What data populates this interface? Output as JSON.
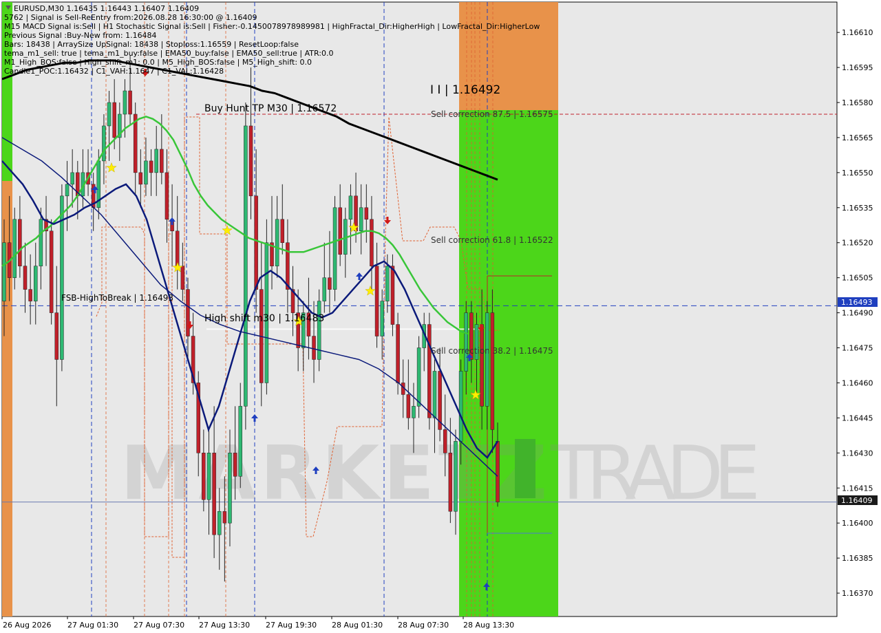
{
  "colors": {
    "background": "#ffffff",
    "plot_background": "#e8e8e8",
    "bull": "#2eb872",
    "bear": "#c0202a",
    "ema50": "#39c639",
    "ema200": "#000000",
    "fast_ma": "#0b1a7a",
    "slow_ma": "#0b1a7a",
    "orange_zone": "#e8924a",
    "green_zone": "#4cd61a",
    "dash_blue": "#1f3fbf",
    "price_box_bg": "#1a1a1a",
    "fsb_box_bg": "#1f3fbf"
  },
  "info_lines": [
    "EURUSD,M30  1.16435 1.16443 1.16407 1.16409",
    "5762 | Signal is Sell-ReEntry from:2026.08.28 16:30:00 @ 1.16409",
    "M15 MACD Signal is:Sell | H1 Stochastic Signal is:Sell | Fisher:-0.1450078978989981 | HighFractal_Dir:HigherHigh | LowFractal_Dir:HigherLow",
    "Previous Signal :Buy-New from: 1.16484",
    "Bars: 18438 | ArraySize UpSignal: 18438 | Stoploss:1.16559 | ResetLoop:false",
    "tema_m1_sell: true | tema_m1_buy:false | EMA50_buy:false | EMA50_sell:true | ATR:0.0",
    "M1_High_BOS:false | High_shift_m1: 0.0 | M5_High_BOS:false | M5_High_shift: 0.0",
    "Candle1_POC:1.16432 | C1_VAH:1.1647 | C1_VAL:1.16428"
  ],
  "annotations": {
    "buy_hunt": "Buy Hunt TP M30 | 1.16572",
    "marker": "I I | 1.16492",
    "sell_875": "Sell correction 87.5 | 1.16575",
    "sell_618": "Sell correction 61.8 | 1.16522",
    "sell_382": "Sell correction 38.2 | 1.16475",
    "fsb": "FSB-HighToBreak | 1.16493",
    "high_shift": "High shift m30 | 1.16483"
  },
  "watermark": {
    "left": "MARKETZ",
    "right": "TRADE"
  },
  "chart_data": {
    "type": "candlestick",
    "symbol": "EURUSD",
    "timeframe": "M30",
    "ylim": [
      1.1636,
      1.16623
    ],
    "y_ticks": [
      "1.16610",
      "1.16595",
      "1.16580",
      "1.16565",
      "1.16550",
      "1.16535",
      "1.16520",
      "1.16505",
      "1.16490",
      "1.16475",
      "1.16460",
      "1.16445",
      "1.16430",
      "1.16415",
      "1.16400",
      "1.16385",
      "1.16370"
    ],
    "x_ticks": [
      "26 Aug 2026",
      "27 Aug 01:30",
      "27 Aug 07:30",
      "27 Aug 13:30",
      "27 Aug 19:30",
      "28 Aug 01:30",
      "28 Aug 07:30",
      "28 Aug 13:30"
    ],
    "current_price": "1.16409",
    "fsb_level": "1.16493",
    "levels": {
      "buy_hunt_tp": 1.16572,
      "sell_correction_875": 1.16575,
      "sell_correction_618": 1.16522,
      "sell_correction_382": 1.16475,
      "fsb_high_to_break": 1.16493,
      "high_shift_m30": 1.16483,
      "current": 1.16409
    },
    "candles": [
      [
        1.16495,
        1.1653,
        1.1648,
        1.1652
      ],
      [
        1.1652,
        1.1654,
        1.16495,
        1.16505
      ],
      [
        1.16505,
        1.16535,
        1.165,
        1.1653
      ],
      [
        1.1653,
        1.1654,
        1.16505,
        1.1651
      ],
      [
        1.1651,
        1.1652,
        1.1649,
        1.165
      ],
      [
        1.165,
        1.16515,
        1.16485,
        1.16495
      ],
      [
        1.16495,
        1.1652,
        1.16485,
        1.1651
      ],
      [
        1.1651,
        1.16535,
        1.165,
        1.1653
      ],
      [
        1.1653,
        1.1654,
        1.1651,
        1.16525
      ],
      [
        1.16525,
        1.1653,
        1.16485,
        1.1649
      ],
      [
        1.1649,
        1.1651,
        1.1645,
        1.1647
      ],
      [
        1.1647,
        1.16545,
        1.16465,
        1.1654
      ],
      [
        1.1654,
        1.16555,
        1.16525,
        1.16545
      ],
      [
        1.16545,
        1.1656,
        1.16535,
        1.1655
      ],
      [
        1.1655,
        1.16555,
        1.1653,
        1.1654
      ],
      [
        1.1654,
        1.1656,
        1.16535,
        1.1655
      ],
      [
        1.1655,
        1.1656,
        1.1654,
        1.16545
      ],
      [
        1.16545,
        1.1655,
        1.16525,
        1.16535
      ],
      [
        1.16535,
        1.1656,
        1.1653,
        1.16555
      ],
      [
        1.16555,
        1.16575,
        1.16545,
        1.1657
      ],
      [
        1.1657,
        1.16585,
        1.16555,
        1.1658
      ],
      [
        1.1658,
        1.1659,
        1.1656,
        1.16565
      ],
      [
        1.16565,
        1.1658,
        1.16555,
        1.16575
      ],
      [
        1.16575,
        1.1659,
        1.16565,
        1.16585
      ],
      [
        1.16585,
        1.166,
        1.1657,
        1.16575
      ],
      [
        1.16575,
        1.1658,
        1.1654,
        1.1655
      ],
      [
        1.1655,
        1.1656,
        1.16535,
        1.16545
      ],
      [
        1.16545,
        1.16565,
        1.1654,
        1.16555
      ],
      [
        1.16555,
        1.1656,
        1.1654,
        1.1655
      ],
      [
        1.1655,
        1.1657,
        1.1654,
        1.1656
      ],
      [
        1.1656,
        1.16575,
        1.16545,
        1.1655
      ],
      [
        1.1655,
        1.1656,
        1.1652,
        1.1653
      ],
      [
        1.1653,
        1.16545,
        1.1651,
        1.16525
      ],
      [
        1.16525,
        1.1654,
        1.165,
        1.1651
      ],
      [
        1.1651,
        1.1652,
        1.16495,
        1.165
      ],
      [
        1.165,
        1.16505,
        1.1647,
        1.1648
      ],
      [
        1.1648,
        1.1649,
        1.16455,
        1.1646
      ],
      [
        1.1646,
        1.16465,
        1.1642,
        1.1643
      ],
      [
        1.1643,
        1.1644,
        1.16405,
        1.1641
      ],
      [
        1.1641,
        1.1644,
        1.16395,
        1.1643
      ],
      [
        1.1643,
        1.1645,
        1.16385,
        1.16395
      ],
      [
        1.16395,
        1.16415,
        1.1638,
        1.16405
      ],
      [
        1.16405,
        1.1642,
        1.16375,
        1.164
      ],
      [
        1.164,
        1.1644,
        1.1639,
        1.1643
      ],
      [
        1.1643,
        1.1645,
        1.1641,
        1.1642
      ],
      [
        1.1642,
        1.1646,
        1.16415,
        1.1645
      ],
      [
        1.1645,
        1.1658,
        1.1644,
        1.1657
      ],
      [
        1.1657,
        1.16595,
        1.1653,
        1.1654
      ],
      [
        1.1654,
        1.1656,
        1.1649,
        1.165
      ],
      [
        1.165,
        1.1652,
        1.1645,
        1.1646
      ],
      [
        1.1646,
        1.1653,
        1.16455,
        1.1652
      ],
      [
        1.1652,
        1.1654,
        1.165,
        1.1651
      ],
      [
        1.1651,
        1.1654,
        1.16505,
        1.1653
      ],
      [
        1.1653,
        1.16545,
        1.16515,
        1.1652
      ],
      [
        1.1652,
        1.1653,
        1.1649,
        1.165
      ],
      [
        1.165,
        1.1651,
        1.1648,
        1.1649
      ],
      [
        1.1649,
        1.165,
        1.16465,
        1.16475
      ],
      [
        1.16475,
        1.16495,
        1.16465,
        1.1649
      ],
      [
        1.1649,
        1.16505,
        1.1647,
        1.1648
      ],
      [
        1.1648,
        1.16495,
        1.1646,
        1.1647
      ],
      [
        1.1647,
        1.165,
        1.16465,
        1.16495
      ],
      [
        1.16495,
        1.1652,
        1.1649,
        1.16505
      ],
      [
        1.16505,
        1.16525,
        1.1649,
        1.165
      ],
      [
        1.165,
        1.1654,
        1.16495,
        1.16535
      ],
      [
        1.16535,
        1.16545,
        1.1651,
        1.16515
      ],
      [
        1.16515,
        1.16535,
        1.16505,
        1.1653
      ],
      [
        1.1653,
        1.16545,
        1.16515,
        1.1654
      ],
      [
        1.1654,
        1.1655,
        1.1652,
        1.16525
      ],
      [
        1.16525,
        1.16545,
        1.16515,
        1.16535
      ],
      [
        1.16535,
        1.16545,
        1.1652,
        1.1653
      ],
      [
        1.1653,
        1.1654,
        1.165,
        1.1651
      ],
      [
        1.1651,
        1.1652,
        1.16475,
        1.1648
      ],
      [
        1.1648,
        1.165,
        1.1647,
        1.16495
      ],
      [
        1.16495,
        1.16515,
        1.1649,
        1.1651
      ],
      [
        1.1651,
        1.16515,
        1.1648,
        1.16485
      ],
      [
        1.16485,
        1.1649,
        1.16455,
        1.1646
      ],
      [
        1.1646,
        1.1647,
        1.16445,
        1.16455
      ],
      [
        1.16455,
        1.1647,
        1.1644,
        1.16445
      ],
      [
        1.16445,
        1.1646,
        1.1643,
        1.1645
      ],
      [
        1.1645,
        1.1648,
        1.16445,
        1.16475
      ],
      [
        1.16475,
        1.1649,
        1.16465,
        1.16485
      ],
      [
        1.16485,
        1.1649,
        1.1644,
        1.16445
      ],
      [
        1.16445,
        1.1647,
        1.1643,
        1.16465
      ],
      [
        1.16465,
        1.16475,
        1.16435,
        1.1644
      ],
      [
        1.1644,
        1.16455,
        1.1642,
        1.1643
      ],
      [
        1.1643,
        1.16445,
        1.164,
        1.16405
      ],
      [
        1.16405,
        1.1644,
        1.16395,
        1.16435
      ],
      [
        1.16435,
        1.1647,
        1.16425,
        1.16465
      ],
      [
        1.16465,
        1.16495,
        1.16455,
        1.1649
      ],
      [
        1.1649,
        1.16495,
        1.1646,
        1.1647
      ],
      [
        1.1647,
        1.1649,
        1.16455,
        1.16485
      ],
      [
        1.16485,
        1.165,
        1.1644,
        1.1645
      ],
      [
        1.1645,
        1.16495,
        1.1644,
        1.1649
      ],
      [
        1.1649,
        1.165,
        1.1643,
        1.1644
      ],
      [
        1.16435,
        1.16443,
        1.16407,
        1.16409
      ]
    ],
    "series": [
      {
        "values": [
          1.1651,
          1.16512,
          1.16515,
          1.16518,
          1.1652,
          1.16522,
          1.16525,
          1.16527,
          1.1653,
          1.16533,
          1.16536,
          1.1654,
          1.16545,
          1.1655,
          1.16555,
          1.1656,
          1.16563,
          1.16566,
          1.16569,
          1.16571,
          1.16573,
          1.16574,
          1.16573,
          1.16571,
          1.16568,
          1.16564,
          1.16558,
          1.16552,
          1.16545,
          1.1654,
          1.16536,
          1.16533,
          1.1653,
          1.16528,
          1.16526,
          1.16524,
          1.16522,
          1.16521,
          1.1652,
          1.16519,
          1.16518,
          1.16517,
          1.16516,
          1.16516,
          1.16516,
          1.16517,
          1.16518,
          1.16519,
          1.1652,
          1.16521,
          1.16522,
          1.16523,
          1.16524,
          1.16525,
          1.16525,
          1.16524,
          1.16522,
          1.16519,
          1.16515,
          1.1651,
          1.16505,
          1.165,
          1.16496,
          1.16492,
          1.16489,
          1.16486,
          1.16484,
          1.16482,
          1.16481
        ]
      },
      {
        "values": [
          1.1659,
          1.16592,
          1.16594,
          1.16595,
          1.16596,
          1.16597,
          1.16597,
          1.16598,
          1.16598,
          1.16598,
          1.16597,
          1.16596,
          1.16595,
          1.16594,
          1.16593,
          1.16592,
          1.16591,
          1.1659,
          1.16589,
          1.16588,
          1.16587,
          1.16585,
          1.16584,
          1.16582,
          1.1658,
          1.16578,
          1.16576,
          1.16574,
          1.16571,
          1.16569,
          1.16567,
          1.16565,
          1.16563,
          1.16561,
          1.16559,
          1.16557,
          1.16555,
          1.16553,
          1.16551,
          1.16549,
          1.16547
        ]
      },
      {
        "values": [
          1.16555,
          1.1655,
          1.16545,
          1.16538,
          1.1653,
          1.16528,
          1.1653,
          1.16532,
          1.16535,
          1.16537,
          1.1654,
          1.16543,
          1.16545,
          1.1654,
          1.1653,
          1.16515,
          1.165,
          1.16485,
          1.1647,
          1.16455,
          1.1644,
          1.1645,
          1.16465,
          1.1648,
          1.16495,
          1.16505,
          1.16508,
          1.16505,
          1.165,
          1.16495,
          1.1649,
          1.16488,
          1.1649,
          1.16495,
          1.165,
          1.16505,
          1.1651,
          1.16512,
          1.16508,
          1.165,
          1.1649,
          1.1648,
          1.1647,
          1.1646,
          1.1645,
          1.1644,
          1.16432,
          1.16428,
          1.16435
        ]
      },
      {
        "values": [
          1.16565,
          1.1656,
          1.16555,
          1.16548,
          1.1654,
          1.16532,
          1.16522,
          1.16512,
          1.16502,
          1.16495,
          1.16489,
          1.16485,
          1.16482,
          1.1648,
          1.16478,
          1.16476,
          1.16474,
          1.16472,
          1.1647,
          1.16466,
          1.1646,
          1.16452,
          1.16444,
          1.16436,
          1.16428,
          1.1642
        ]
      }
    ]
  }
}
